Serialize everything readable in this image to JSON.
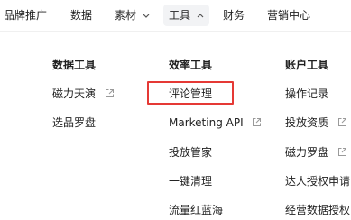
{
  "nav": {
    "items": [
      {
        "label": "品牌推广"
      },
      {
        "label": "数据"
      },
      {
        "label": "素材",
        "caret": true
      },
      {
        "label": "工具",
        "caret": true,
        "active": true
      },
      {
        "label": "财务"
      },
      {
        "label": "营销中心"
      }
    ]
  },
  "menu": {
    "columns": [
      {
        "title": "数据工具",
        "items": [
          {
            "label": "磁力天演",
            "external": true
          },
          {
            "label": "选品罗盘",
            "external": false
          }
        ]
      },
      {
        "title": "效率工具",
        "items": [
          {
            "label": "评论管理",
            "external": false,
            "highlighted": true
          },
          {
            "label": "Marketing API",
            "external": true
          },
          {
            "label": "投放管家",
            "external": false
          },
          {
            "label": "一键清理",
            "external": false
          },
          {
            "label": "流量红蓝海",
            "external": false
          }
        ]
      },
      {
        "title": "账户工具",
        "items": [
          {
            "label": "操作记录",
            "external": false
          },
          {
            "label": "投放资质",
            "external": true
          },
          {
            "label": "磁力罗盘",
            "external": true
          },
          {
            "label": "达人授权申请",
            "external": false
          },
          {
            "label": "经营数据授权",
            "external": false
          }
        ]
      }
    ]
  },
  "colors": {
    "text": "#1f1f1f",
    "active_bg": "#f2f3f5",
    "highlight": "#e53935",
    "icon": "#9a9a9a"
  },
  "icons": {
    "caret_down": "chevron-down-icon",
    "external": "external-link-icon"
  }
}
